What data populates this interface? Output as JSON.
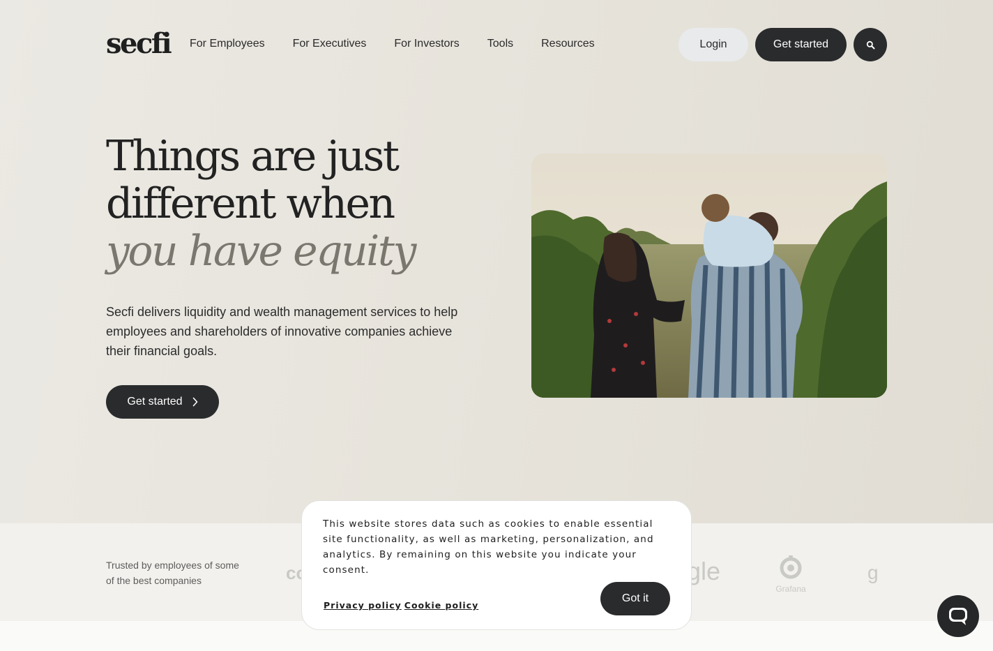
{
  "header": {
    "logo": "secfi",
    "nav": [
      "For Employees",
      "For Executives",
      "For Investors",
      "Tools",
      "Resources"
    ],
    "login_label": "Login",
    "get_started_label": "Get started"
  },
  "hero": {
    "headline_line1": "Things are just",
    "headline_line2": "different when",
    "headline_line3": "you have equity",
    "description": "Secfi delivers liquidity and wealth management services to help employees and shareholders of innovative companies achieve their financial goals.",
    "cta_label": "Get started"
  },
  "trusted": {
    "text": "Trusted by employees of some of the best companies",
    "logos": [
      "co",
      "gle",
      "Grafana",
      "g"
    ]
  },
  "cookie_banner": {
    "message": "This website stores data such as cookies to enable essential site functionality, as well as marketing, personalization, and analytics. By remaining on this website you indicate your consent.",
    "privacy_link": "Privacy policy",
    "cookie_link": "Cookie policy",
    "button_label": "Got it"
  },
  "icons": {
    "search": "search-icon",
    "chevron": "chevron-right-icon",
    "chat": "chat-bubble-icon",
    "grafana": "grafana-logo-icon"
  }
}
